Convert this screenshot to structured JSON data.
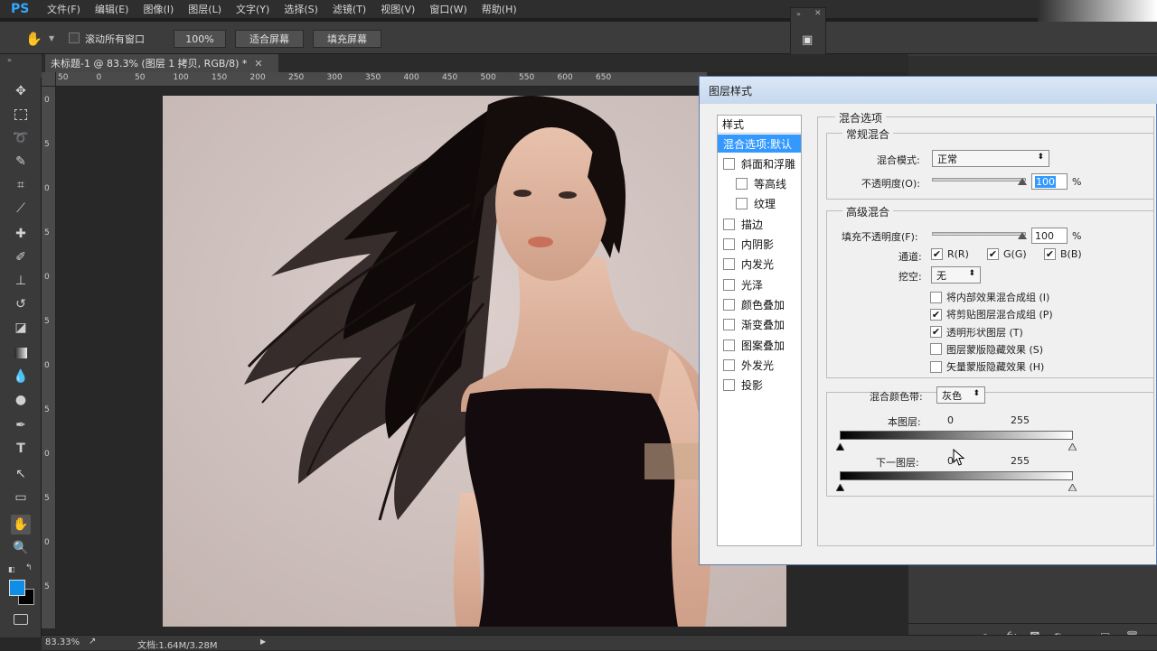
{
  "app": {
    "logo": "PS",
    "menu": [
      "文件(F)",
      "编辑(E)",
      "图像(I)",
      "图层(L)",
      "文字(Y)",
      "选择(S)",
      "滤镜(T)",
      "视图(V)",
      "窗口(W)",
      "帮助(H)"
    ]
  },
  "options": {
    "scroll_all_label": "滚动所有窗口",
    "zoom_btn": "100%",
    "fit_screen_btn": "适合屏幕",
    "fill_screen_btn": "填充屏幕"
  },
  "document": {
    "tab_title": "未标题-1 @ 83.3% (图层 1 拷贝, RGB/8) *",
    "ruler_h": [
      "50",
      "0",
      "50",
      "100",
      "150",
      "200",
      "250",
      "300",
      "350",
      "400",
      "450",
      "500",
      "550",
      "600",
      "650"
    ],
    "ruler_v": [
      "0",
      "5",
      "0",
      "5",
      "0",
      "5",
      "0",
      "5",
      "0",
      "5",
      "0",
      "5"
    ]
  },
  "status": {
    "zoom": "83.33%",
    "doc_size": "文档:1.64M/3.28M"
  },
  "dialog": {
    "title": "图层样式",
    "styles_header": "样式",
    "styles": [
      {
        "label": "混合选项:默认",
        "checkbox": false,
        "indent": false,
        "selected": true
      },
      {
        "label": "斜面和浮雕",
        "checkbox": true,
        "indent": false,
        "selected": false
      },
      {
        "label": "等高线",
        "checkbox": true,
        "indent": true,
        "selected": false
      },
      {
        "label": "纹理",
        "checkbox": true,
        "indent": true,
        "selected": false
      },
      {
        "label": "描边",
        "checkbox": true,
        "indent": false,
        "selected": false
      },
      {
        "label": "内阴影",
        "checkbox": true,
        "indent": false,
        "selected": false
      },
      {
        "label": "内发光",
        "checkbox": true,
        "indent": false,
        "selected": false
      },
      {
        "label": "光泽",
        "checkbox": true,
        "indent": false,
        "selected": false
      },
      {
        "label": "颜色叠加",
        "checkbox": true,
        "indent": false,
        "selected": false
      },
      {
        "label": "渐变叠加",
        "checkbox": true,
        "indent": false,
        "selected": false
      },
      {
        "label": "图案叠加",
        "checkbox": true,
        "indent": false,
        "selected": false
      },
      {
        "label": "外发光",
        "checkbox": true,
        "indent": false,
        "selected": false
      },
      {
        "label": "投影",
        "checkbox": true,
        "indent": false,
        "selected": false
      }
    ],
    "blend_options_title": "混合选项",
    "general_title": "常规混合",
    "blend_mode_label": "混合模式:",
    "blend_mode_value": "正常",
    "opacity_label": "不透明度(O):",
    "opacity_value": "100",
    "percent": "%",
    "advanced_title": "高级混合",
    "fill_opacity_label": "填充不透明度(F):",
    "fill_opacity_value": "100",
    "channels_label": "通道:",
    "channel_r": "R(R)",
    "channel_g": "G(G)",
    "channel_b": "B(B)",
    "knockout_label": "挖空:",
    "knockout_value": "无",
    "options": [
      {
        "label": "将内部效果混合成组 (I)",
        "checked": false
      },
      {
        "label": "将剪贴图层混合成组 (P)",
        "checked": true
      },
      {
        "label": "透明形状图层 (T)",
        "checked": true
      },
      {
        "label": "图层蒙版隐藏效果 (S)",
        "checked": false
      },
      {
        "label": "矢量蒙版隐藏效果 (H)",
        "checked": false
      }
    ],
    "blend_if_label": "混合颜色带:",
    "blend_if_value": "灰色",
    "this_layer_label": "本图层:",
    "this_layer_min": "0",
    "this_layer_max": "255",
    "underlying_label": "下一图层:",
    "underlying_min": "0",
    "underlying_max": "255"
  },
  "colors": {
    "accent": "#31a8ff",
    "selection": "#3399ff"
  }
}
